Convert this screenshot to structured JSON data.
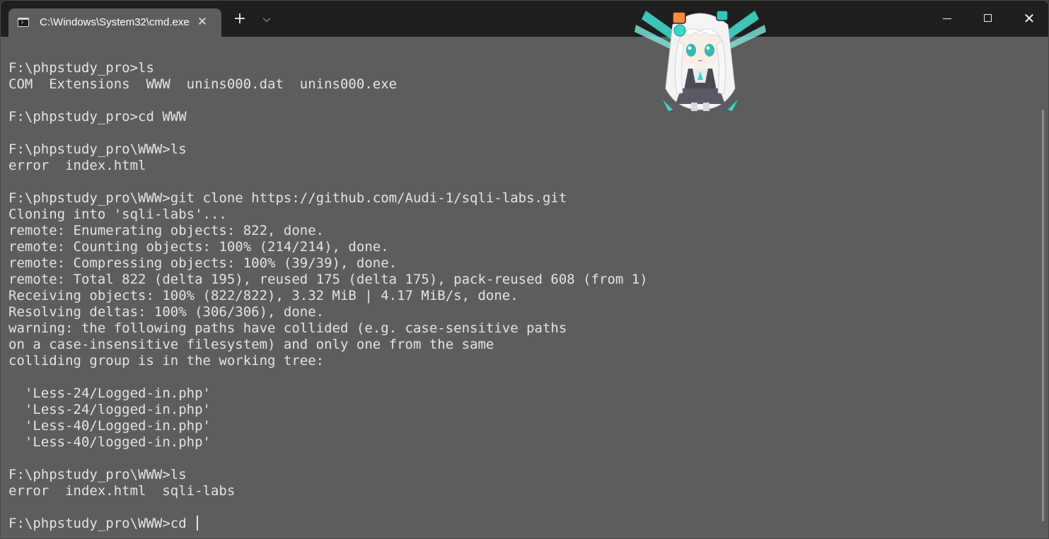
{
  "tab": {
    "title": "C:\\Windows\\System32\\cmd.exe",
    "icon": "console-icon",
    "close_icon": "close-icon"
  },
  "tabbar": {
    "new_tab_glyph": "+",
    "dropdown_glyph": "⌵"
  },
  "window_controls": {
    "close_glyph": "✕"
  },
  "terminal": {
    "lines": [
      "F:\\phpstudy_pro>ls",
      "COM  Extensions  WWW  unins000.dat  unins000.exe",
      "",
      "F:\\phpstudy_pro>cd WWW",
      "",
      "F:\\phpstudy_pro\\WWW>ls",
      "error  index.html",
      "",
      "F:\\phpstudy_pro\\WWW>git clone https://github.com/Audi-1/sqli-labs.git",
      "Cloning into 'sqli-labs'...",
      "remote: Enumerating objects: 822, done.",
      "remote: Counting objects: 100% (214/214), done.",
      "remote: Compressing objects: 100% (39/39), done.",
      "remote: Total 822 (delta 195), reused 175 (delta 175), pack-reused 608 (from 1)",
      "Receiving objects: 100% (822/822), 3.32 MiB | 4.17 MiB/s, done.",
      "Resolving deltas: 100% (306/306), done.",
      "warning: the following paths have collided (e.g. case-sensitive paths",
      "on a case-insensitive filesystem) and only one from the same",
      "colliding group is in the working tree:",
      "",
      "  'Less-24/Logged-in.php'",
      "  'Less-24/logged-in.php'",
      "  'Less-40/Logged-in.php'",
      "  'Less-40/logged-in.php'",
      "",
      "F:\\phpstudy_pro\\WWW>ls",
      "error  index.html  sqli-labs",
      "",
      "F:\\phpstudy_pro\\WWW>cd "
    ]
  },
  "colors": {
    "titlebar": "#1f1f1f",
    "terminal_background": "#5d5d5d",
    "terminal_text": "#e4e4e4",
    "mascot_accent": "#3fd6c8"
  },
  "mascot": {
    "icon": "anime-mascot-icon"
  }
}
